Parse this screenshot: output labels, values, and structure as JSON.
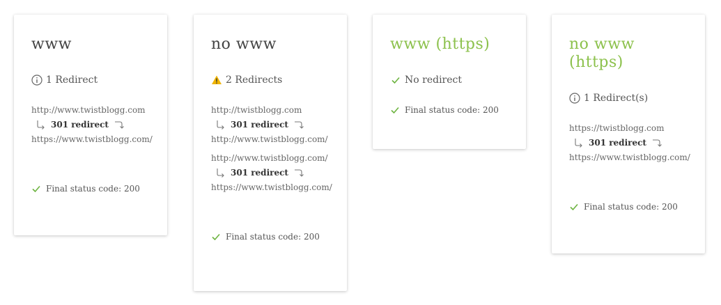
{
  "cards": [
    {
      "title": "www",
      "summary": "1 Redirect",
      "summary_icon": "info-icon",
      "urls": [
        "http://www.twistblogg.com",
        "https://www.twistblogg.com/"
      ],
      "hops": [
        "301 redirect"
      ],
      "final": "Final status code: 200"
    },
    {
      "title": "no www",
      "summary": "2 Redirects",
      "summary_icon": "warning-icon",
      "urls": [
        "http://twistblogg.com",
        "http://www.twistblogg.com/",
        "http://www.twistblogg.com/",
        "https://www.twistblogg.com/"
      ],
      "hops": [
        "301 redirect",
        "301 redirect"
      ],
      "final": "Final status code: 200"
    },
    {
      "title": "www (https)",
      "summary": "No redirect",
      "summary_icon": "check-icon",
      "final": "Final status code: 200"
    },
    {
      "title_line1": "no www",
      "title_line2": "(https)",
      "summary": "1 Redirect(s)",
      "summary_icon": "info-icon",
      "urls": [
        "https://twistblogg.com",
        "https://www.twistblogg.com/"
      ],
      "hops": [
        "301 redirect"
      ],
      "final": "Final status code: 200"
    }
  ],
  "colors": {
    "accent_green": "#8cc14c",
    "warning_yellow": "#f0b400",
    "text": "#555555"
  }
}
